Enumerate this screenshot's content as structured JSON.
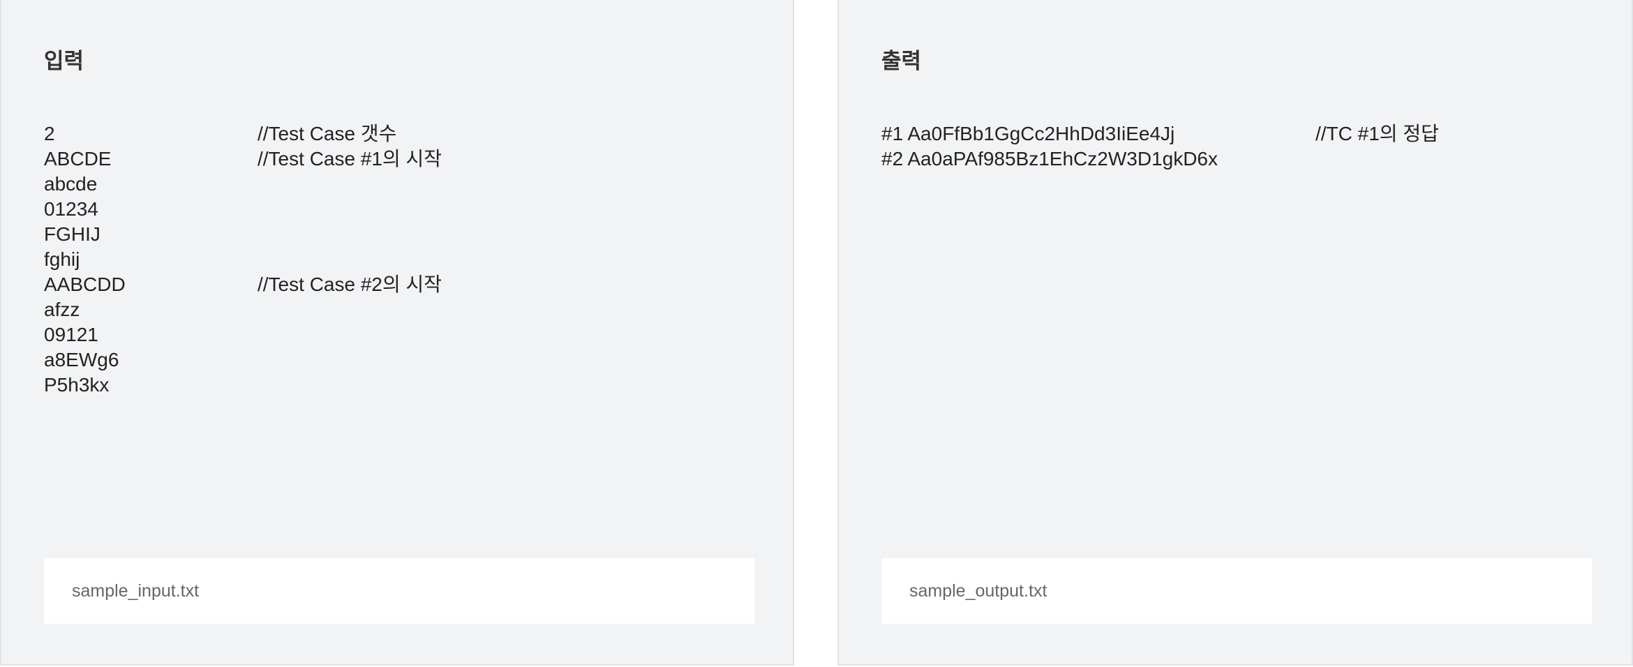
{
  "input": {
    "title": "입력",
    "lines": [
      "2",
      "ABCDE",
      "abcde",
      "01234",
      "FGHIJ",
      "fghij",
      "AABCDD",
      "afzz",
      "09121",
      "a8EWg6",
      "P5h3kx"
    ],
    "comments": [
      "//Test Case 갯수",
      "//Test Case #1의 시작",
      "",
      "",
      "",
      "",
      "//Test Case #2의 시작",
      "",
      "",
      "",
      ""
    ],
    "file": "sample_input.txt"
  },
  "output": {
    "title": "출력",
    "lines": [
      "#1 Aa0FfBb1GgCc2HhDd3IiEe4Jj",
      "#2 Aa0aPAf985Bz1EhCz2W3D1gkD6x"
    ],
    "comments": [
      "//TC #1의 정답",
      ""
    ],
    "file": "sample_output.txt"
  }
}
